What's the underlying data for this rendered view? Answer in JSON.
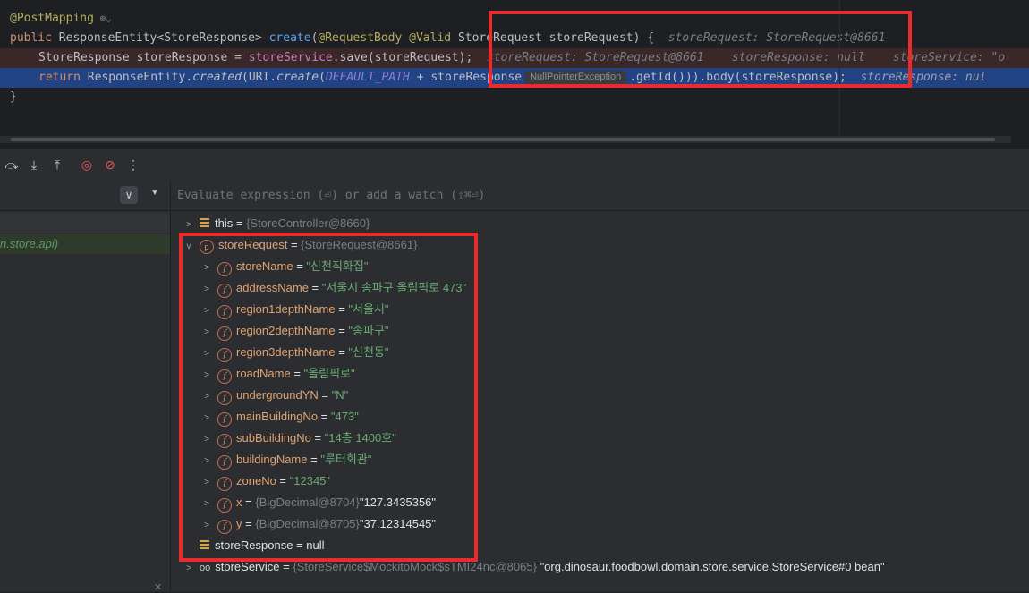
{
  "editor": {
    "annotation": "@PostMapping",
    "annotation_icon": "globe-icon",
    "line2": {
      "kw_public": "public",
      "sig_part1": " ResponseEntity<StoreResponse> ",
      "method": "create",
      "paren": "(",
      "ann_body": "@RequestBody",
      "space1": " ",
      "ann_valid": "@Valid",
      "sig_part2": " StoreRequest storeRequest) {",
      "hint": "storeRequest: StoreRequest@8661"
    },
    "line3": {
      "lhs": "StoreResponse storeResponse = ",
      "field": "storeService",
      "rhs": ".save(storeRequest);",
      "hint1": "storeRequest: StoreRequest@8661",
      "hint2": "storeResponse: null",
      "hint3": "storeService: \"o"
    },
    "line4": {
      "kw_return": "return",
      "part1": " ResponseEntity.",
      "created": "created",
      "part2": "(URI.",
      "create": "create",
      "part3": "(",
      "default_path": "DEFAULT_PATH",
      "part4": " + storeResponse",
      "npe": "NullPointerException",
      "part5": ".getId())).body(storeResponse);",
      "hint": "storeResponse: nul"
    },
    "closing_brace": "}"
  },
  "toolbar": {
    "icons": [
      "step-over-icon",
      "step-into-icon",
      "step-out-icon",
      "view-breakpoints-icon",
      "mute-breakpoints-icon",
      "more-icon"
    ],
    "more_glyph": "⋮"
  },
  "frames": {
    "selected_frame": "n.store.api)",
    "filter_icon": "filter-icon"
  },
  "evaluate": {
    "placeholder": "Evaluate expression (⏎) or add a watch (⇧⌘⏎)"
  },
  "variables": {
    "this": {
      "name": "this",
      "eq": " = ",
      "ref": "{StoreController@8660}"
    },
    "store_request": {
      "name": "storeRequest",
      "eq": " = ",
      "ref": "{StoreRequest@8661}"
    },
    "fields": [
      {
        "name": "storeName",
        "eq": " = ",
        "value": "\"신천직화집\""
      },
      {
        "name": "addressName",
        "eq": " = ",
        "value": "\"서울시 송파구 올림픽로 473\""
      },
      {
        "name": "region1depthName",
        "eq": " = ",
        "value": "\"서울시\""
      },
      {
        "name": "region2depthName",
        "eq": " = ",
        "value": "\"송파구\""
      },
      {
        "name": "region3depthName",
        "eq": " = ",
        "value": "\"신천동\""
      },
      {
        "name": "roadName",
        "eq": " = ",
        "value": "\"올림픽로\""
      },
      {
        "name": "undergroundYN",
        "eq": " = ",
        "value": "\"N\""
      },
      {
        "name": "mainBuildingNo",
        "eq": " = ",
        "value": "\"473\""
      },
      {
        "name": "subBuildingNo",
        "eq": " = ",
        "value": "\"14층 1400호\""
      },
      {
        "name": "buildingName",
        "eq": " = ",
        "value": "\"루터회관\""
      },
      {
        "name": "zoneNo",
        "eq": " = ",
        "value": "\"12345\""
      }
    ],
    "x": {
      "name": "x",
      "eq": " = ",
      "ref": "{BigDecimal@8704}",
      "value": "\"127.3435356\""
    },
    "y": {
      "name": "y",
      "eq": " = ",
      "ref": "{BigDecimal@8705}",
      "value": "\"37.12314545\""
    },
    "store_response": {
      "name": "storeResponse",
      "eq": " = ",
      "value": "null"
    },
    "store_service": {
      "name": "storeService",
      "eq": " = ",
      "ref": "{StoreService$MockitoMock$sTMI24nc@8065}",
      "value": "\"org.dinosaur.foodbowl.domain.store.service.StoreService#0 bean\""
    }
  },
  "colors": {
    "highlight_box": "#ea2b2b",
    "selected_line": "#214283",
    "error_line": "#3a2727"
  }
}
